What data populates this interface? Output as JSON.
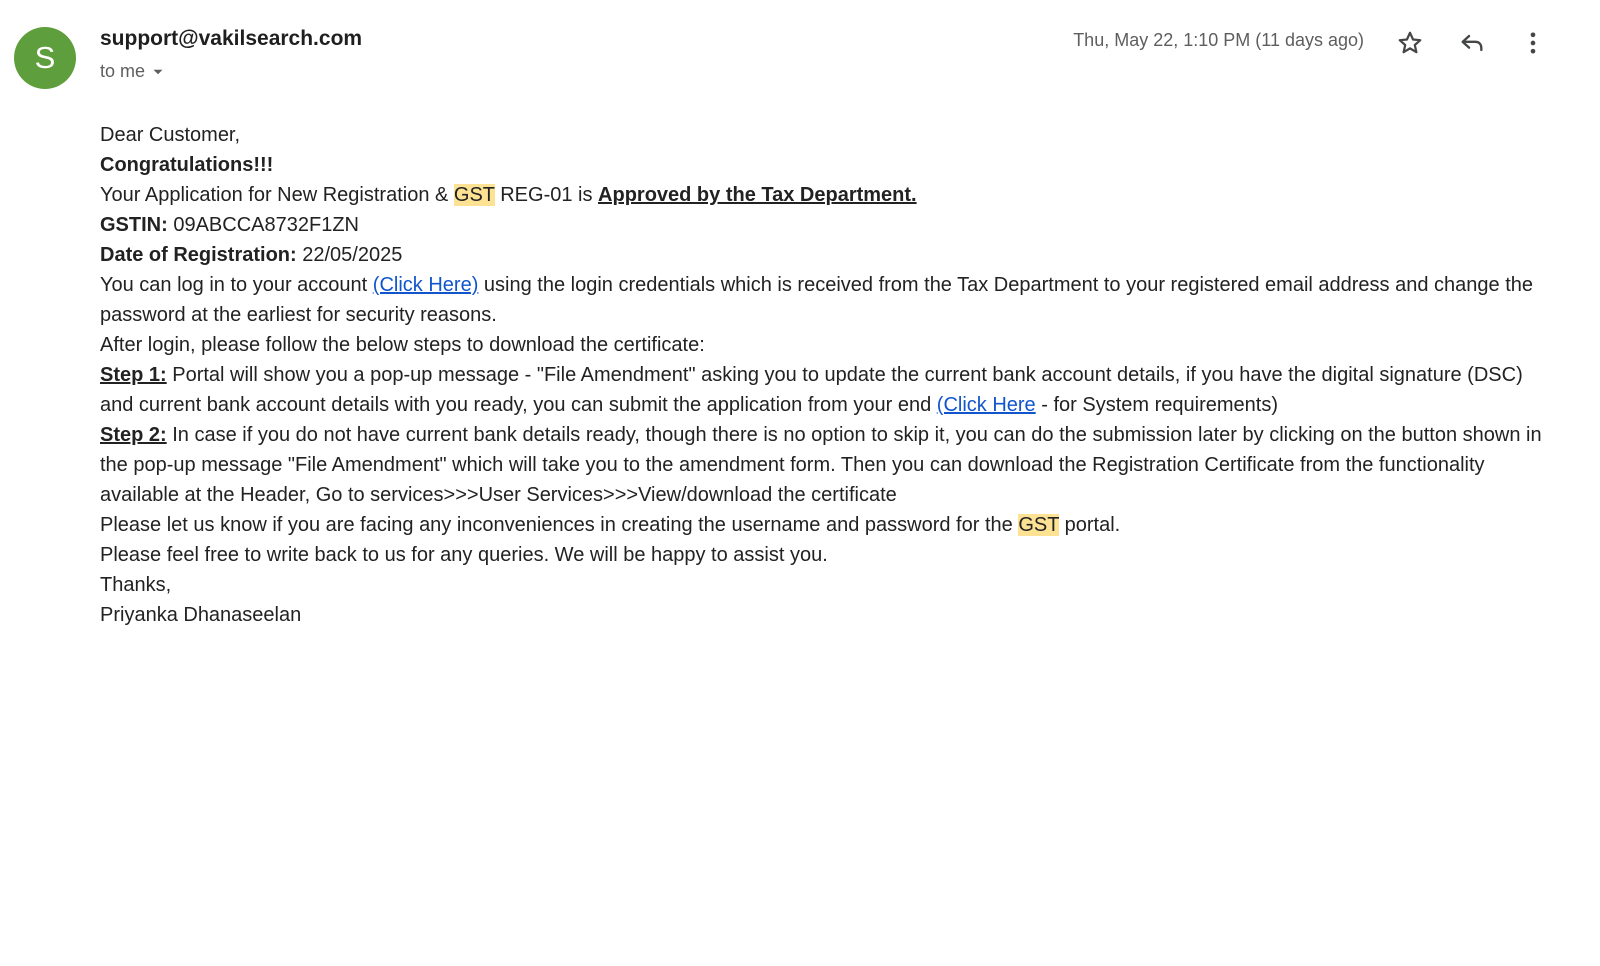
{
  "header": {
    "avatar_letter": "S",
    "avatar_color": "#5f9e3c",
    "sender": "support@vakilsearch.com",
    "recipient": "to me",
    "date": "Thu, May 22, 1:10 PM (11 days ago)",
    "icons": [
      "star-icon",
      "reply-icon",
      "more-vertical-icon"
    ]
  },
  "body": {
    "greeting": "Dear Customer,",
    "congrats": "Congratulations!!!",
    "approval": {
      "text1": "Your Application for New Registration & ",
      "highlight": "GST",
      "text2": " REG-01 is ",
      "approved": "Approved by the Tax Department."
    },
    "gstin": {
      "label": "GSTIN:",
      "value": " 09ABCCA8732F1ZN"
    },
    "registration_date": {
      "label": "Date of Registration:",
      "value": " 22/05/2025"
    },
    "login": {
      "text1": "You can log in to your account ",
      "link": "(Click Here)",
      "text2": " using the login credentials which is received from the Tax Department to your registered email address and change the password at the earliest for security reasons."
    },
    "after_login": "After login, please follow the below steps to download the certificate:",
    "step1": {
      "label": "Step 1:",
      "text1": " Portal will show you a pop-up message - \"File Amendment\" asking you to update the current bank account details, if you have the digital signature (DSC) and current bank account details with you ready, you can submit the application from your end ",
      "link": "(Click Here",
      "text2": " - for System requirements)"
    },
    "step2": {
      "label": "Step 2:",
      "text": " In case if you do not have current bank details ready, though there is no option to skip it, you can do the submission later by clicking on the button shown in the pop-up message \"File Amendment\" which will take you to the amendment form. Then you can download the Registration Certificate from the functionality available at the Header, Go to services>>>User Services>>>View/download the certificate"
    },
    "inconvenience": {
      "text1": "Please let us know if you are facing any inconveniences in creating the username and password for the ",
      "highlight": "GST",
      "text2": " portal."
    },
    "feel_free": "Please feel free to write back to us for any queries. We will be happy to assist you.",
    "thanks": "Thanks,",
    "signature": "Priyanka Dhanaseelan"
  },
  "colors": {
    "highlight": "#fde293",
    "link": "#1155cc"
  }
}
